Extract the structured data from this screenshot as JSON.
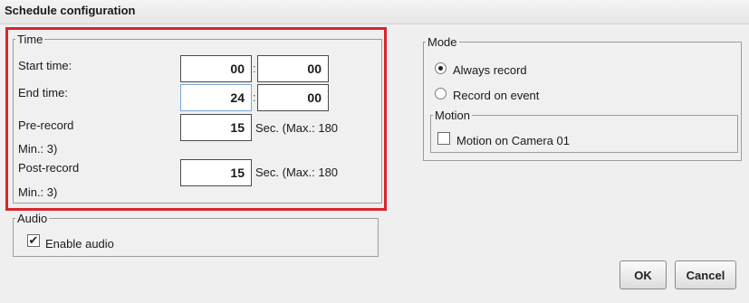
{
  "title": "Schedule configuration",
  "time": {
    "legend": "Time",
    "start_label": "Start time:",
    "start_hour": "00",
    "start_min": "00",
    "end_label": "End time:",
    "end_hour": "24",
    "end_min": "00",
    "separator": ":",
    "prerecord_label": "Pre-record",
    "prerecord_value": "15",
    "prerecord_hint": "Sec. (Max.: 180",
    "prerecord_hint2": "Min.: 3)",
    "postrecord_label": "Post-record",
    "postrecord_value": "15",
    "postrecord_hint": "Sec. (Max.: 180",
    "postrecord_hint2": "Min.: 3)"
  },
  "audio": {
    "legend": "Audio",
    "enable_label": "Enable audio",
    "enabled": true
  },
  "mode": {
    "legend": "Mode",
    "always_label": "Always record",
    "event_label": "Record on event",
    "selected": "always"
  },
  "motion": {
    "legend": "Motion",
    "camera_label": "Motion on Camera 01",
    "checked": false
  },
  "buttons": {
    "ok": "OK",
    "cancel": "Cancel"
  },
  "colors": {
    "highlight": "#d8242c",
    "background": "#efefef"
  }
}
